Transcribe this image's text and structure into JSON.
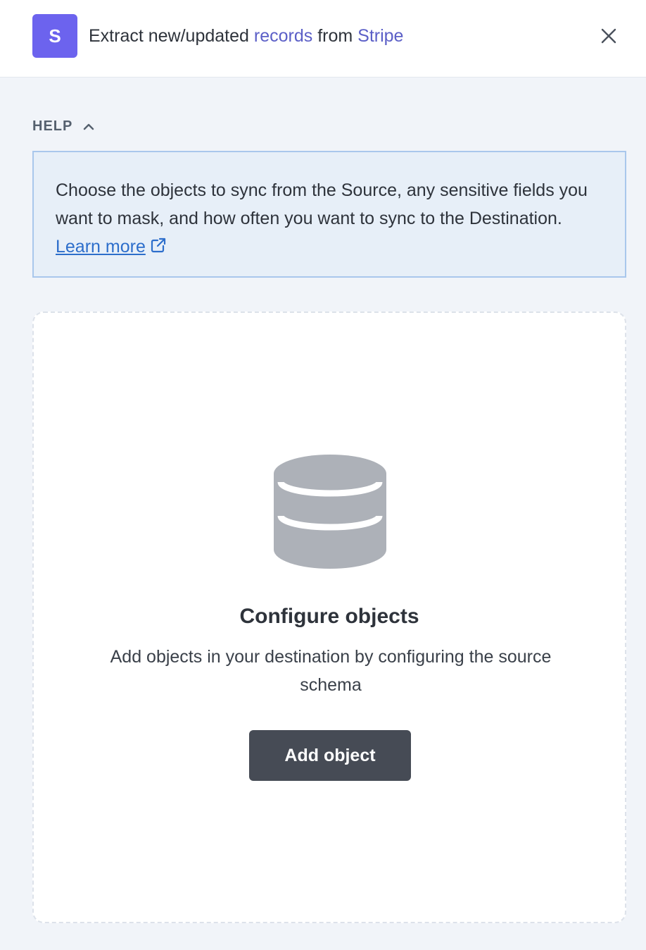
{
  "header": {
    "logo_letter": "S",
    "title_prefix": "Extract new/updated ",
    "title_records": "records",
    "title_mid": " from ",
    "title_source": "Stripe",
    "close_icon": "close-icon"
  },
  "help": {
    "label": "HELP",
    "toggle_icon": "chevron-up-icon",
    "text": "Choose the objects to sync from the Source, any sensitive fields you want to mask, and how often you want to sync to the Destination.",
    "link_label": "Learn more",
    "link_icon": "external-link-icon"
  },
  "empty_state": {
    "icon": "database-icon",
    "title": "Configure objects",
    "description": "Add objects in your destination by configuring the source schema",
    "button_label": "Add object"
  },
  "colors": {
    "brand": "#6c63ee",
    "accent_text": "#5b5fc7",
    "link": "#2d6ecb",
    "help_bg": "#e7eff8",
    "help_border": "#a9c7ec",
    "button_bg": "#464b55",
    "page_bg": "#f1f4f9"
  }
}
